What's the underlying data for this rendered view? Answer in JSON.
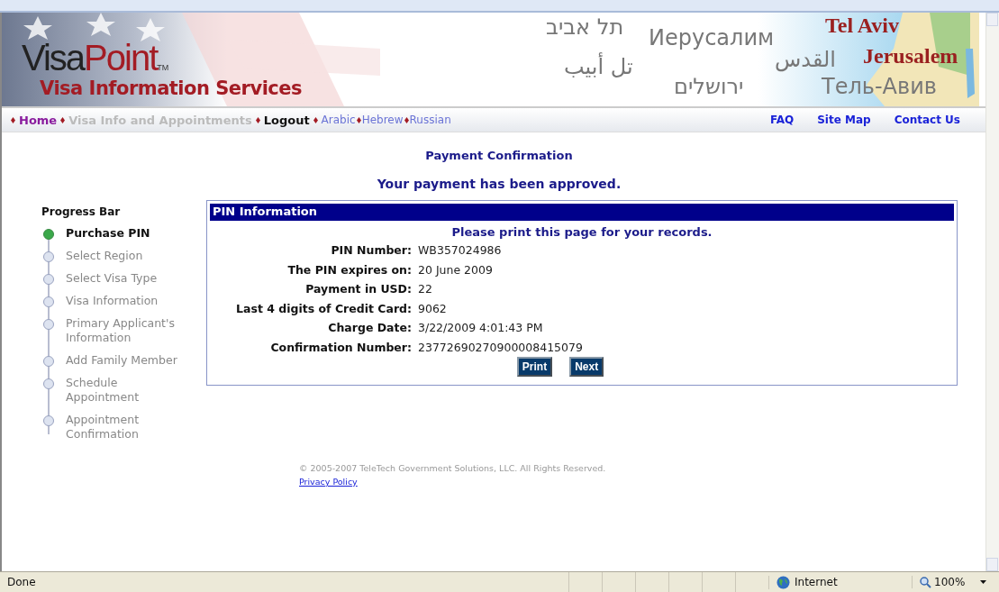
{
  "banner": {
    "logo_dark": "Visa",
    "logo_red": "Point",
    "trademark": "TM",
    "tagline": "Visa Information Services",
    "cities": [
      {
        "text": "תל אביב",
        "kind": "plain"
      },
      {
        "text": "Иерусалим",
        "kind": "plain"
      },
      {
        "text": "Tel Aviv",
        "kind": "accent"
      },
      {
        "text": "تل أبيب",
        "kind": "plain"
      },
      {
        "text": "القدس",
        "kind": "plain"
      },
      {
        "text": "Jerusalem",
        "kind": "accent"
      },
      {
        "text": "ירושלים",
        "kind": "plain"
      },
      {
        "text": "Тель-Авив",
        "kind": "plain"
      }
    ]
  },
  "nav": {
    "items": [
      {
        "label": "Home",
        "kind": "main",
        "disabled": false
      },
      {
        "label": "Visa Info and Appointments",
        "kind": "main",
        "disabled": true
      },
      {
        "label": "Logout",
        "kind": "main",
        "disabled": false
      },
      {
        "label": "Arabic",
        "kind": "lang",
        "disabled": false
      },
      {
        "label": "Hebrew",
        "kind": "lang",
        "disabled": false
      },
      {
        "label": "Russian",
        "kind": "lang",
        "disabled": false
      }
    ],
    "right_links": [
      "FAQ",
      "Site Map",
      "Contact Us"
    ]
  },
  "page_title": "Payment Confirmation",
  "message": "Your payment has been approved.",
  "progress": {
    "title": "Progress Bar",
    "steps": [
      {
        "label": "Purchase PIN",
        "selected": true
      },
      {
        "label": "Select Region",
        "selected": false
      },
      {
        "label": "Select Visa Type",
        "selected": false
      },
      {
        "label": "Visa Information",
        "selected": false
      },
      {
        "label": "Primary Applicant's Information",
        "selected": false
      },
      {
        "label": "Add Family Member",
        "selected": false
      },
      {
        "label": "Schedule Appointment",
        "selected": false
      },
      {
        "label": "Appointment Confirmation",
        "selected": false
      }
    ]
  },
  "pin_panel": {
    "title": "PIN Information",
    "note": "Please print this page for your records.",
    "fields": [
      {
        "label": "PIN Number:",
        "value": "WB357024986"
      },
      {
        "label": "The PIN expires on:",
        "value": "20 June 2009"
      },
      {
        "label": "Payment in USD:",
        "value": "22"
      },
      {
        "label": "Last 4 digits of Credit Card:",
        "value": "9062"
      },
      {
        "label": "Charge Date:",
        "value": "3/22/2009 4:01:43 PM"
      },
      {
        "label": "Confirmation Number:",
        "value": "23772690270900008415079"
      }
    ],
    "buttons": [
      "Print",
      "Next"
    ]
  },
  "footer": {
    "copyright": "© 2005-2007 TeleTech Government Solutions, LLC. All Rights Reserved.",
    "privacy_link": "Privacy Policy"
  },
  "status_bar": {
    "status": "Done",
    "zone": "Internet",
    "zoom": "100%"
  }
}
